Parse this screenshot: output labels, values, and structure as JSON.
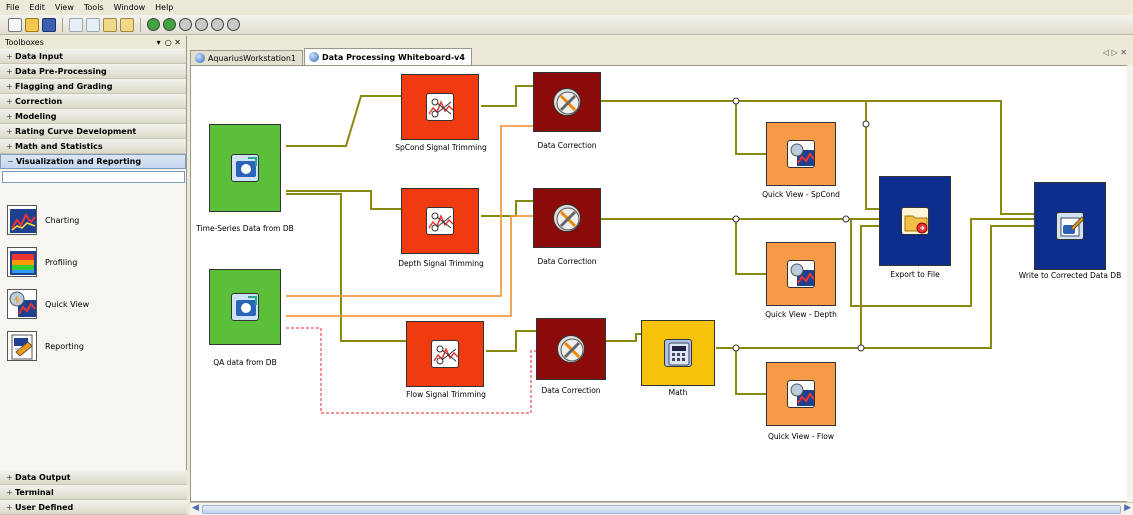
{
  "menu": [
    "File",
    "Edit",
    "View",
    "Tools",
    "Window",
    "Help"
  ],
  "sidebar": {
    "title": "Toolboxes",
    "controls": "▾  ○ ✕",
    "categories_top": [
      "Data Input",
      "Data Pre-Processing",
      "Flagging and Grading",
      "Correction",
      "Modeling",
      "Rating Curve Development",
      "Math and Statistics",
      "Visualization and Reporting"
    ],
    "tools": [
      "Charting",
      "Profiling",
      "Quick View",
      "Reporting"
    ],
    "categories_bottom": [
      "Data Output",
      "Terminal",
      "User Defined"
    ]
  },
  "tabs": [
    {
      "label": "AquariusWorkstation1",
      "active": false
    },
    {
      "label": "Data Processing Whiteboard-v4",
      "active": true
    }
  ],
  "tab_scroll": "◁ ▷ ✕",
  "nodes": {
    "ts_db": "Time-Series Data from DB",
    "qa_db": "QA data from DB",
    "spcond_trim": "SpCond Signal Trimming",
    "depth_trim": "Depth Signal Trimming",
    "flow_trim": "Flow Signal Trimming",
    "corr1": "Data Correction",
    "corr2": "Data Correction",
    "corr3": "Data Correction",
    "math": "Math",
    "qv_spcond": "Quick View - SpCond",
    "qv_depth": "Quick View - Depth",
    "qv_flow": "Quick View - Flow",
    "export": "Export to File",
    "write_db": "Write to Corrected Data DB"
  },
  "colors": {
    "source": "#5cbf3a",
    "trim": "#f03a10",
    "correction": "#8b0a0a",
    "quickview": "#f59a45",
    "math": "#f6c20a",
    "output": "#0d2e8c",
    "wire": "#8a8a10",
    "wire_qa": "#f39a45"
  }
}
